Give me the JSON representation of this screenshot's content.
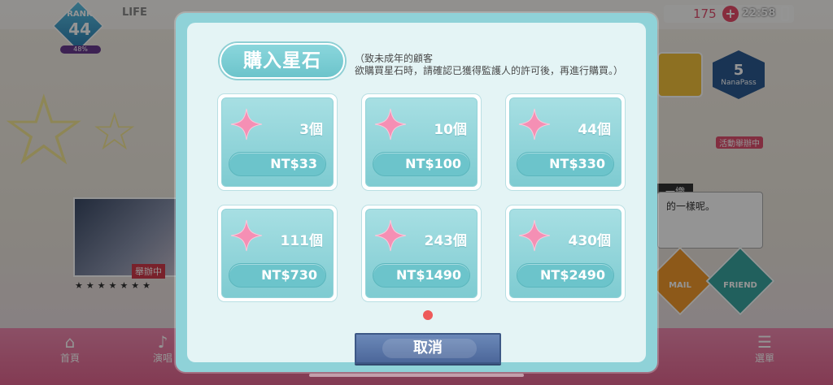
{
  "hud": {
    "rank_label": "RANK",
    "rank_value": "44",
    "exp_label": "48%",
    "life_label": "LIFE",
    "stone_count": "175",
    "clock": "22:58"
  },
  "background": {
    "thumbnail_tag": "舉辦中",
    "rating_stars": "★★★★★★★",
    "nanapass_count": "5",
    "nanapass_label": "NanaPass",
    "event_label": "活動舉辦中",
    "speaker_name": "一織",
    "speech_text": "的一樣呢。",
    "mail_label": "MAIL",
    "friend_label": "FRIEND",
    "nav": [
      {
        "label": "首頁",
        "icon": "home-icon"
      },
      {
        "label": "演唱",
        "icon": "music-icon"
      },
      {
        "label": "選單",
        "icon": "menu-icon"
      }
    ]
  },
  "dialog": {
    "title": "購入星石",
    "notice_line1": "（致未成年的顧客",
    "notice_line2": "欲購買星石時，請確認已獲得監護人的許可後，再進行購買。）",
    "packages": [
      {
        "quantity": "3個",
        "price": "NT$33"
      },
      {
        "quantity": "10個",
        "price": "NT$100"
      },
      {
        "quantity": "44個",
        "price": "NT$330"
      },
      {
        "quantity": "111個",
        "price": "NT$730"
      },
      {
        "quantity": "243個",
        "price": "NT$1490"
      },
      {
        "quantity": "430個",
        "price": "NT$2490"
      }
    ],
    "cancel_label": "取消"
  },
  "colors": {
    "dialog_frame": "#8fd2d8",
    "card_face": "#7ecbd1",
    "gem_pink": "#f58fb4",
    "cancel_button": "#5570a6",
    "page_dot": "#ee5a5a"
  }
}
